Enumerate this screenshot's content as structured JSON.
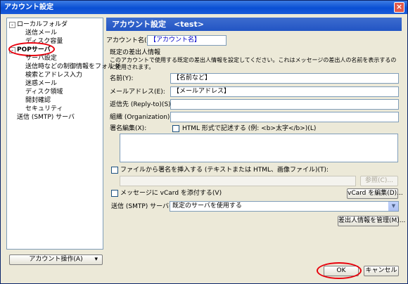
{
  "window": {
    "title": "アカウント設定",
    "close_glyph": "×"
  },
  "tree": {
    "items": [
      {
        "label": "ローカルフォルダ",
        "expander": "-"
      },
      {
        "label": "送信メール"
      },
      {
        "label": "ディスク容量"
      },
      {
        "label": "POPサーバ",
        "expander": "-"
      },
      {
        "label": "サーバ設定"
      },
      {
        "label": "送信時などの制御情報をフォルダ"
      },
      {
        "label": "検索とアドレス入力"
      },
      {
        "label": "迷惑メール"
      },
      {
        "label": "ディスク領域"
      },
      {
        "label": "開封確認"
      },
      {
        "label": "セキュリティ"
      },
      {
        "label": "送信 (SMTP) サーバ"
      }
    ]
  },
  "account_actions_button": {
    "label": "アカウント操作(A)",
    "arrow": "▾"
  },
  "panel": {
    "header": "アカウント設定　<test>",
    "account_name_label": "アカウント名(N):",
    "account_name_value": "【アカウント名】",
    "identity_title": "既定の差出人情報",
    "identity_desc": "このアカウントで使用する既定の差出人情報を設定してください。これはメッセージの差出人の名前を表示するのに使用されます。",
    "name_label": "名前(Y):",
    "name_value": "【名前など】",
    "email_label": "メールアドレス(E):",
    "email_value": "【メールアドレス】",
    "reply_label": "返信先 (Reply-to)(S):",
    "reply_value": "",
    "org_label": "組織 (Organization)(O):",
    "org_value": "",
    "signature_label": "署名編集(X):",
    "html_check_label": "HTML 形式で記述する (例: <b>太字</b>)(L)",
    "file_sig_label": "ファイルから署名を挿入する (テキストまたは HTML、画像ファイル)(T):",
    "browse_label": "参照(C)...",
    "vcard_label": "メッセージに vCard を添付する(V)",
    "vcard_edit_label": "vCard を編集(D)...",
    "smtp_label": "送信 (SMTP) サーバ(U):",
    "smtp_value": "既定のサーバを使用する",
    "manage_identities_label": "差出人情報を管理(M)..."
  },
  "footer": {
    "ok_label": "OK",
    "cancel_label": "キャンセル"
  }
}
